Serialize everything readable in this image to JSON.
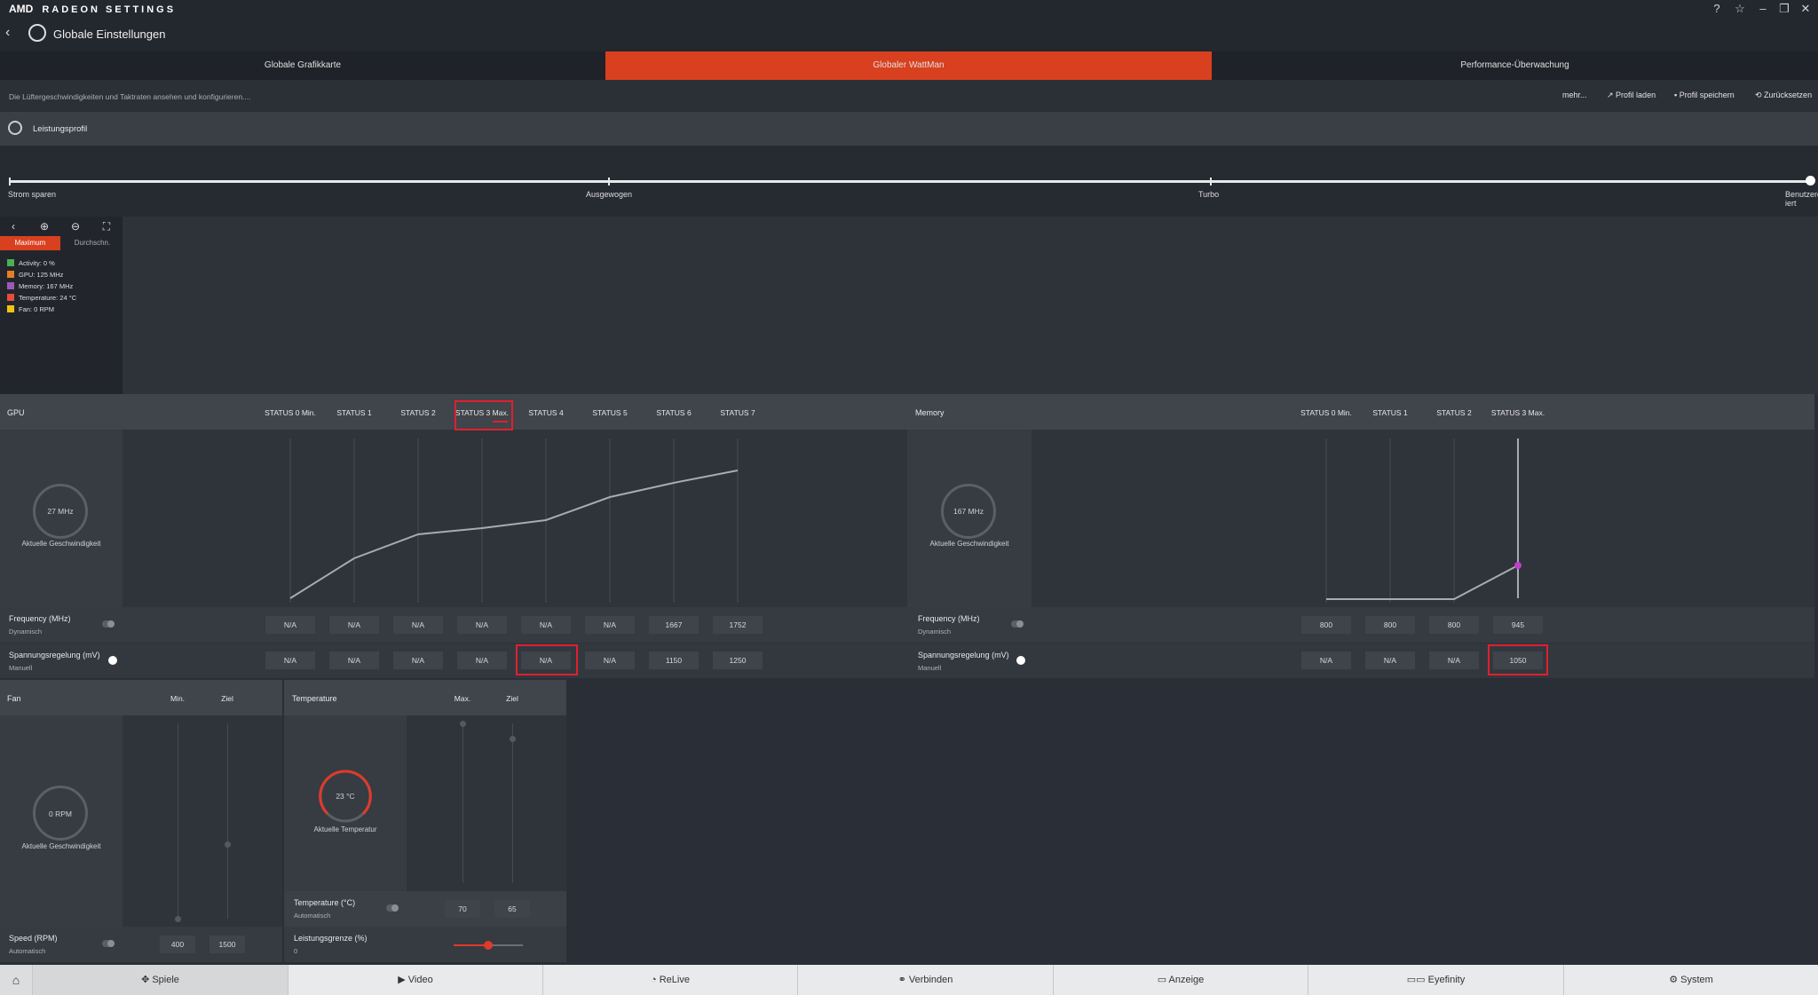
{
  "app": {
    "brand_logo": "AMD",
    "brand_name": "RADEON SETTINGS",
    "titlebar_icons": [
      "help-icon",
      "star-icon",
      "minimize-icon",
      "restore-icon",
      "close-icon"
    ],
    "page_title": "Globale Einstellungen"
  },
  "tabs": [
    {
      "label": "Globale Grafikkarte",
      "active": false
    },
    {
      "label": "Globaler WattMan",
      "active": true
    },
    {
      "label": "Performance-Überwachung",
      "active": false
    }
  ],
  "subbar": {
    "description": "Die Lüftergeschwindigkeiten und Taktraten ansehen und konfigurieren....",
    "more": "mehr...",
    "load_profile": "Profil laden",
    "save_profile": "Profil speichern",
    "reset": "Zurücksetzen"
  },
  "profile": {
    "label": "Leistungsprofil",
    "stops": [
      "Strom sparen",
      "Ausgewogen",
      "Turbo",
      "Benutzerdefin\niert"
    ],
    "selected_index": 3
  },
  "monitor": {
    "mode_max": "Maximum",
    "mode_avg": "Durchschn.",
    "legend": [
      {
        "label": "Activity: 0 %",
        "color": "#4caf50"
      },
      {
        "label": "GPU: 125 MHz",
        "color": "#e67e22"
      },
      {
        "label": "Memory: 167 MHz",
        "color": "#9b59b6"
      },
      {
        "label": "Temperature: 24 °C",
        "color": "#e74c3c"
      },
      {
        "label": "Fan: 0 RPM",
        "color": "#f1c40f"
      }
    ]
  },
  "gpu": {
    "title": "GPU",
    "states": [
      "STATUS 0 Min.",
      "STATUS 1",
      "STATUS 2",
      "STATUS 3 Max.",
      "STATUS 4",
      "STATUS 5",
      "STATUS 6",
      "STATUS 7"
    ],
    "dial_value": "27 MHz",
    "dial_label": "Aktuelle Geschwindigkeit",
    "freq_label": "Frequency (MHz)",
    "freq_mode": "Dynamisch",
    "freq_values": [
      "N/A",
      "N/A",
      "N/A",
      "N/A",
      "N/A",
      "N/A",
      "1667",
      "1752"
    ],
    "volt_label": "Spannungsregelung (mV)",
    "volt_mode": "Manuell",
    "volt_values": [
      "N/A",
      "N/A",
      "N/A",
      "N/A",
      "N/A",
      "N/A",
      "1150",
      "1250"
    ]
  },
  "memory": {
    "title": "Memory",
    "states": [
      "STATUS 0 Min.",
      "STATUS 1",
      "STATUS 2",
      "STATUS 3 Max."
    ],
    "dial_value": "167 MHz",
    "dial_label": "Aktuelle Geschwindigkeit",
    "freq_label": "Frequency (MHz)",
    "freq_mode": "Dynamisch",
    "freq_values": [
      "800",
      "800",
      "800",
      "945"
    ],
    "volt_label": "Spannungsregelung (mV)",
    "volt_mode": "Manuell",
    "volt_values": [
      "N/A",
      "N/A",
      "N/A",
      "1050"
    ]
  },
  "fan": {
    "title": "Fan",
    "col_min": "Min.",
    "col_target": "Ziel",
    "dial_value": "0 RPM",
    "dial_label": "Aktuelle Geschwindigkeit",
    "speed_label": "Speed (RPM)",
    "speed_mode": "Automatisch",
    "speed_min": "400",
    "speed_target": "1500"
  },
  "temperature": {
    "title": "Temperature",
    "col_max": "Max.",
    "col_target": "Ziel",
    "dial_value": "23 °C",
    "dial_label": "Aktuelle Temperatur",
    "temp_label": "Temperature (°C)",
    "temp_mode": "Automatisch",
    "temp_max": "70",
    "temp_target": "65",
    "power_label": "Leistungsgrenze (%)",
    "power_value": "0"
  },
  "bottom_nav": [
    {
      "label": "Spiele",
      "icon": "gamepad-icon"
    },
    {
      "label": "Video",
      "icon": "play-icon"
    },
    {
      "label": "ReLive",
      "icon": "relive-icon"
    },
    {
      "label": "Verbinden",
      "icon": "share-icon"
    },
    {
      "label": "Anzeige",
      "icon": "monitor-icon"
    },
    {
      "label": "Eyefinity",
      "icon": "eyefinity-icon"
    },
    {
      "label": "System",
      "icon": "system-icon"
    }
  ]
}
